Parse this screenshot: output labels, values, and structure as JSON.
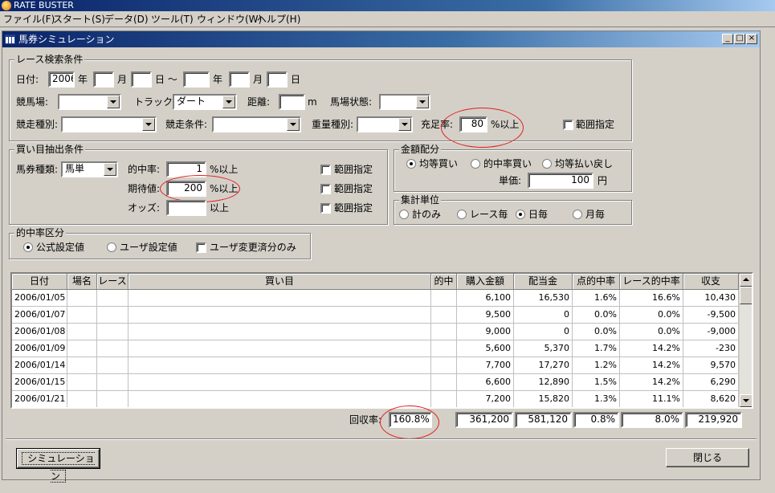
{
  "app": {
    "title": "RATE BUSTER"
  },
  "menu": {
    "file": "ファイル(F)",
    "start": "スタート(S)",
    "data": "データ(D)",
    "tool": "ツール(T)",
    "window": "ウィンドウ(W)",
    "help": "ヘルプ(H)"
  },
  "window": {
    "title": "馬券シミュレーション",
    "min": "_",
    "max": "□",
    "close": "×"
  },
  "race_search": {
    "legend": "レース検索条件",
    "date_label": "日付:",
    "from_year": "2006",
    "year1": "年",
    "from_month": "",
    "month1": "月",
    "from_day": "",
    "day1": "日 ～",
    "to_year": "",
    "year2": "年",
    "to_month": "",
    "month2": "月",
    "to_day": "",
    "day2": "日",
    "course_label": "競馬場:",
    "course_value": "",
    "track_label": "トラック:",
    "track_value": "ダート",
    "distance_label": "距離:",
    "distance_value": "",
    "distance_unit": "m",
    "ground_label": "馬場状態:",
    "ground_value": "",
    "race_type_label": "競走種別:",
    "race_type_value": "",
    "race_cond_label": "競走条件:",
    "race_cond_value": "",
    "weight_label": "重量種別:",
    "weight_value": "",
    "fill_label": "充足率:",
    "fill_value": "80",
    "fill_unit": "%以上",
    "range_label": "範囲指定"
  },
  "bet_extract": {
    "legend": "買い目抽出条件",
    "ticket_label": "馬券種類:",
    "ticket_value": "馬単",
    "hit_label": "的中率:",
    "hit_value": "1",
    "hit_unit": "%以上",
    "expect_label": "期待値:",
    "expect_value": "200",
    "expect_unit": "%以上",
    "odds_label": "オッズ:",
    "odds_value": "",
    "odds_unit": "以上",
    "range1": "範囲指定",
    "range2": "範囲指定",
    "range3": "範囲指定"
  },
  "amount": {
    "legend": "金額配分",
    "opt1": "均等買い",
    "opt2": "的中率買い",
    "opt3": "均等払い戻し",
    "unit_label": "単価:",
    "unit_value": "100",
    "unit_suffix": "円"
  },
  "aggregate": {
    "legend": "集計単位",
    "opt1": "計のみ",
    "opt2": "レース毎",
    "opt3": "日毎",
    "opt4": "月毎"
  },
  "hit_class": {
    "legend": "的中率区分",
    "opt1": "公式設定値",
    "opt2": "ユーザ設定値",
    "opt3": "ユーザ変更済分のみ"
  },
  "table": {
    "headers": [
      "日付",
      "場名",
      "レース",
      "買い目",
      "的中",
      "購入金額",
      "配当金",
      "点的中率",
      "レース的中率",
      "収支"
    ],
    "rows": [
      [
        "2006/01/05",
        "",
        "",
        "",
        "",
        "6,100",
        "16,530",
        "1.6%",
        "16.6%",
        "10,430"
      ],
      [
        "2006/01/07",
        "",
        "",
        "",
        "",
        "9,500",
        "0",
        "0.0%",
        "0.0%",
        "-9,500"
      ],
      [
        "2006/01/08",
        "",
        "",
        "",
        "",
        "9,000",
        "0",
        "0.0%",
        "0.0%",
        "-9,000"
      ],
      [
        "2006/01/09",
        "",
        "",
        "",
        "",
        "5,600",
        "5,370",
        "1.7%",
        "14.2%",
        "-230"
      ],
      [
        "2006/01/14",
        "",
        "",
        "",
        "",
        "7,700",
        "17,270",
        "1.2%",
        "14.2%",
        "9,570"
      ],
      [
        "2006/01/15",
        "",
        "",
        "",
        "",
        "6,600",
        "12,890",
        "1.5%",
        "14.2%",
        "6,290"
      ],
      [
        "2006/01/21",
        "",
        "",
        "",
        "",
        "7,200",
        "15,820",
        "1.3%",
        "11.1%",
        "8,620"
      ]
    ]
  },
  "totals": {
    "recovery_label": "回収率:",
    "recovery_value": "160.8%",
    "purchase": "361,200",
    "payout": "581,120",
    "point_hit": "0.8%",
    "race_hit": "8.0%",
    "balance": "219,920"
  },
  "buttons": {
    "simulate": "シミュレーション",
    "close": "閉じる"
  }
}
